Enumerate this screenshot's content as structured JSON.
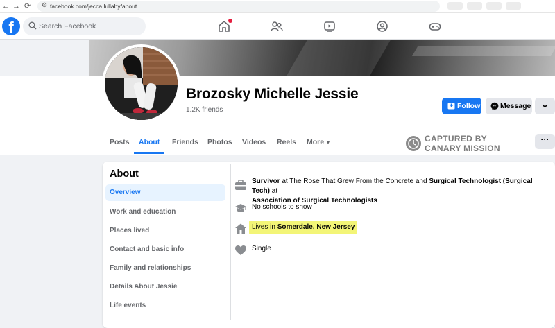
{
  "browser": {
    "back_icon": "←",
    "forward_icon": "→",
    "reload_icon": "⟳",
    "url": "facebook.com/jecca.lullaby/about"
  },
  "header": {
    "logo": "f",
    "search_placeholder": "Search Facebook",
    "nav_icons": [
      "home-icon",
      "friends-icon",
      "watch-icon",
      "groups-icon",
      "gaming-icon"
    ]
  },
  "profile": {
    "name": "Brozosky Michelle Jessie",
    "friends": "1.2K friends",
    "follow_label": "Follow",
    "message_label": "Message"
  },
  "tabs": [
    "Posts",
    "About",
    "Friends",
    "Photos",
    "Videos",
    "Reels",
    "More"
  ],
  "watermark": {
    "line1": "CAPTURED BY",
    "line2": "CANARY MISSION"
  },
  "about": {
    "title": "About",
    "sidebar": [
      "Overview",
      "Work and education",
      "Places lived",
      "Contact and basic info",
      "Family and relationships",
      "Details About Jessie",
      "Life events"
    ],
    "work": {
      "role1": "Survivor",
      "at1": " at The Rose That Grew From the Concrete and ",
      "role2": "Surgical Technologist (Surgical Tech)",
      "at2": " at",
      "org": "Association of Surgical Technologists"
    },
    "school": "No schools to show",
    "lives_prefix": "Lives in ",
    "lives_city": "Somerdale, New Jersey",
    "relationship": "Single"
  },
  "colors": {
    "brand": "#1877f2",
    "highlight": "#f3f577",
    "notif": "#e41e3f"
  }
}
